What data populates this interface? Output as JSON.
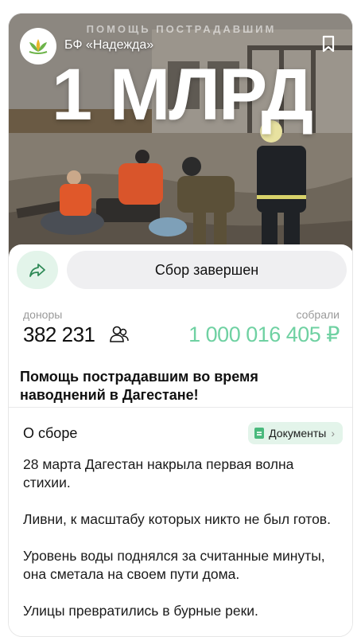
{
  "hero": {
    "top_caption": "ПОМОЩЬ ПОСТРАДАВШИМ",
    "headline": "1 МЛРД",
    "org_name": "БФ «Надежда»",
    "logo": "lotus-logo-icon",
    "bookmark": "bookmark-icon"
  },
  "actions": {
    "share_icon": "share-arrow-icon",
    "status_label": "Сбор завершен"
  },
  "stats": {
    "donors_label": "доноры",
    "donors_value": "382 231",
    "donors_icon": "people-icon",
    "raised_label": "собрали",
    "raised_value": "1 000 016 405 ₽",
    "raised_color": "#6fd1a2"
  },
  "title": "Помощь пострадавшим во время наводнений в Дагестане!",
  "about": {
    "heading": "О сборе",
    "docs_label": "Документы",
    "paragraphs": [
      "28 марта Дагестан накрыла первая волна стихии.",
      "Ливни, к масштабу которых никто не был готов.",
      "Уровень воды поднялся за считанные минуты, она сметала на своем пути дома.",
      "Улицы превратились в бурные реки."
    ]
  },
  "colors": {
    "accent_green": "#49b97c",
    "accent_green_soft": "#e3f4ea",
    "gray_button": "#efeff1"
  }
}
